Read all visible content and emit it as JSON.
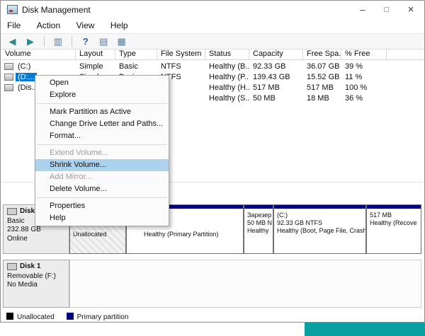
{
  "window": {
    "title": "Disk Management"
  },
  "titlebar_controls": {
    "minimize": "–",
    "maximize": "□",
    "close": "×"
  },
  "menu_bar": {
    "items": [
      "File",
      "Action",
      "View",
      "Help"
    ]
  },
  "toolbar": {
    "icons": [
      {
        "name": "back-icon",
        "glyph": "◀"
      },
      {
        "name": "forward-icon",
        "glyph": "▶"
      },
      {
        "name": "console-tree-icon",
        "glyph": "▥"
      },
      {
        "name": "help-icon",
        "glyph": "?"
      },
      {
        "name": "action-pane-icon",
        "glyph": "▤"
      },
      {
        "name": "views-icon",
        "glyph": "▦"
      }
    ]
  },
  "volume_list": {
    "columns": [
      "Volume",
      "Layout",
      "Type",
      "File System",
      "Status",
      "Capacity",
      "Free Spa...",
      "% Free"
    ],
    "rows": [
      {
        "volume": "(C:)",
        "layout": "Simple",
        "type": "Basic",
        "file_system": "NTFS",
        "status": "Healthy (B...",
        "capacity": "92.33 GB",
        "free_space": "36.07 GB",
        "pct_free": "39 %"
      },
      {
        "volume": "(D:...",
        "layout": "Simple",
        "type": "Basic",
        "file_system": "NTFS",
        "status": "Healthy (P...",
        "capacity": "139.43 GB",
        "free_space": "15.52 GB",
        "pct_free": "11 %"
      },
      {
        "volume": "(Dis...",
        "layout": "",
        "type": "",
        "file_system": "",
        "status": "Healthy (H...",
        "capacity": "517 MB",
        "free_space": "517 MB",
        "pct_free": "100 %"
      },
      {
        "volume": "",
        "layout": "",
        "type": "",
        "file_system": "",
        "status": "Healthy (S...",
        "capacity": "50 MB",
        "free_space": "18 MB",
        "pct_free": "36 %"
      }
    ]
  },
  "context_menu": {
    "items": [
      {
        "label": "Open",
        "state": "normal"
      },
      {
        "label": "Explore",
        "state": "normal"
      },
      {
        "label": "Mark Partition as Active",
        "state": "normal"
      },
      {
        "label": "Change Drive Letter and Paths...",
        "state": "normal"
      },
      {
        "label": "Format...",
        "state": "normal"
      },
      {
        "label": "Extend Volume...",
        "state": "disabled"
      },
      {
        "label": "Shrink Volume...",
        "state": "highlighted"
      },
      {
        "label": "Add Mirror...",
        "state": "disabled"
      },
      {
        "label": "Delete Volume...",
        "state": "normal"
      },
      {
        "label": "Properties",
        "state": "normal"
      },
      {
        "label": "Help",
        "state": "normal"
      }
    ]
  },
  "graphical_view": {
    "disk0": {
      "name": "Disk 0",
      "type": "Basic",
      "size": "232.88 GB",
      "status": "Online",
      "partitions": {
        "unallocated": {
          "label": "Unallocated"
        },
        "primary": {
          "label": "Healthy (Primary Partition)"
        },
        "reserved": {
          "line1": "Зарезер",
          "line2": "50 MB N",
          "line3": "Healthy"
        },
        "c_drive": {
          "line1": "(C:)",
          "line2": "92.33 GB NTFS",
          "line3": "Healthy (Boot, Page File, Crash"
        },
        "recovery": {
          "line1": "517 MB",
          "line2": "Healthy (Recove"
        }
      }
    },
    "disk1": {
      "name": "Disk 1",
      "type": "Removable (F:)",
      "status": "No Media"
    }
  },
  "legend": {
    "unallocated": "Unallocated",
    "primary": "Primary partition"
  },
  "colors": {
    "selection": "#0078d7",
    "menu_highlight": "#abd3f0",
    "primary_partition": "#000082",
    "unallocated_swatch": "#000000",
    "desktop": "#0a9fa0"
  }
}
